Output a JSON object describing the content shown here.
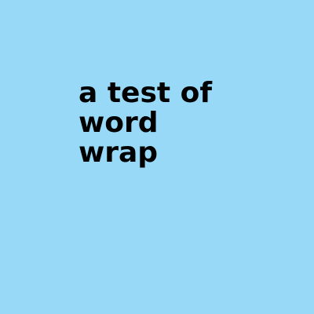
{
  "text": "a test of word wrap",
  "colors": {
    "background": "#97D9F7",
    "text": "#000000"
  }
}
